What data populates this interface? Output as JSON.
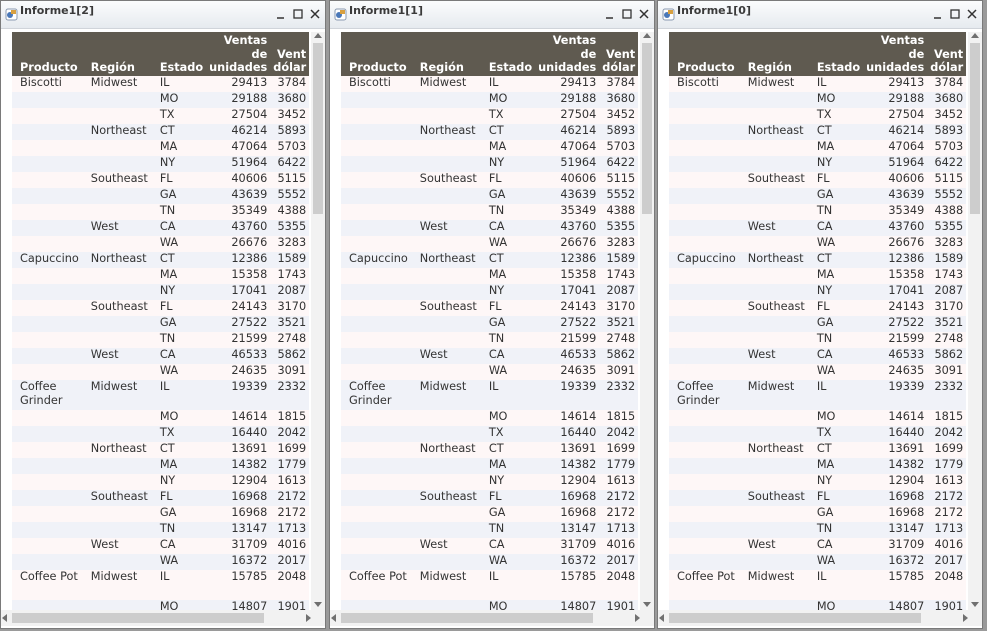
{
  "windows": [
    {
      "title": "Informe1[2]"
    },
    {
      "title": "Informe1[1]"
    },
    {
      "title": "Informe1[0]"
    }
  ],
  "window_icon": "report-app-icon",
  "title_buttons": {
    "minimize": "minimize-icon",
    "maximize": "maximize-icon",
    "close": "close-icon"
  },
  "colors": {
    "header_bg": "#5f5a50",
    "row_odd": "#fef7f7",
    "row_even": "#f0f2f8"
  },
  "table": {
    "columns": [
      "Producto",
      "Región",
      "Estado",
      "Ventas de unidades",
      "Ventas en dólares"
    ],
    "visible_columns": [
      "Producto",
      "Región",
      "Estado",
      "Ventas\nde\nunidades",
      "Vent\ndólar"
    ],
    "rows": [
      [
        "Biscotti",
        "Midwest",
        "IL",
        "29413",
        "3784"
      ],
      [
        "",
        "",
        "MO",
        "29188",
        "3680"
      ],
      [
        "",
        "",
        "TX",
        "27504",
        "3452"
      ],
      [
        "",
        "Northeast",
        "CT",
        "46214",
        "5893"
      ],
      [
        "",
        "",
        "MA",
        "47064",
        "5703"
      ],
      [
        "",
        "",
        "NY",
        "51964",
        "6422"
      ],
      [
        "",
        "Southeast",
        "FL",
        "40606",
        "5115"
      ],
      [
        "",
        "",
        "GA",
        "43639",
        "5552"
      ],
      [
        "",
        "",
        "TN",
        "35349",
        "4388"
      ],
      [
        "",
        "West",
        "CA",
        "43760",
        "5355"
      ],
      [
        "",
        "",
        "WA",
        "26676",
        "3283"
      ],
      [
        "Capuccino",
        "Northeast",
        "CT",
        "12386",
        "1589"
      ],
      [
        "",
        "",
        "MA",
        "15358",
        "1743"
      ],
      [
        "",
        "",
        "NY",
        "17041",
        "2087"
      ],
      [
        "",
        "Southeast",
        "FL",
        "24143",
        "3170"
      ],
      [
        "",
        "",
        "GA",
        "27522",
        "3521"
      ],
      [
        "",
        "",
        "TN",
        "21599",
        "2748"
      ],
      [
        "",
        "West",
        "CA",
        "46533",
        "5862"
      ],
      [
        "",
        "",
        "WA",
        "24635",
        "3091"
      ],
      [
        "Coffee Grinder",
        "Midwest",
        "IL",
        "19339",
        "2332"
      ],
      [
        "",
        "",
        "MO",
        "14614",
        "1815"
      ],
      [
        "",
        "",
        "TX",
        "16440",
        "2042"
      ],
      [
        "",
        "Northeast",
        "CT",
        "13691",
        "1699"
      ],
      [
        "",
        "",
        "MA",
        "14382",
        "1779"
      ],
      [
        "",
        "",
        "NY",
        "12904",
        "1613"
      ],
      [
        "",
        "Southeast",
        "FL",
        "16968",
        "2172"
      ],
      [
        "",
        "",
        "GA",
        "16968",
        "2172"
      ],
      [
        "",
        "",
        "TN",
        "13147",
        "1713"
      ],
      [
        "",
        "West",
        "CA",
        "31709",
        "4016"
      ],
      [
        "",
        "",
        "WA",
        "16372",
        "2017"
      ],
      [
        "Coffee Pot",
        "Midwest",
        "IL",
        "15785",
        "2048"
      ],
      [
        "",
        "",
        "MO",
        "14807",
        "1901"
      ]
    ]
  }
}
